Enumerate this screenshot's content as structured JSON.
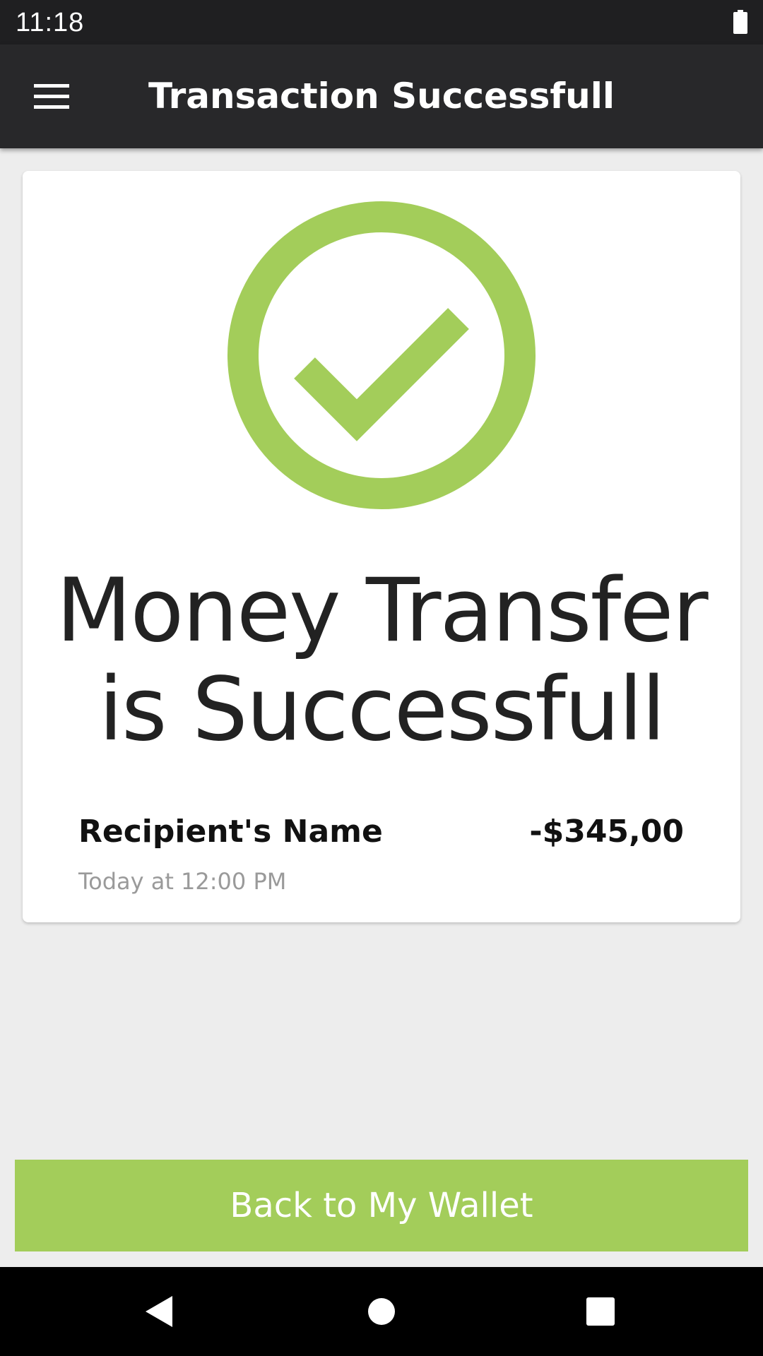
{
  "status_bar": {
    "time": "11:18",
    "battery_icon": "battery-full-icon"
  },
  "app_bar": {
    "menu_icon": "hamburger-menu-icon",
    "title": "Transaction Successfull"
  },
  "card": {
    "success_icon": "check-circle-icon",
    "headline": "Money Transfer is Successfull",
    "recipient_name": "Recipient's Name",
    "amount": "-$345,00",
    "time": "Today at 12:00 PM"
  },
  "action": {
    "wallet_button_label": "Back to My Wallet"
  },
  "nav_bar": {
    "back_icon": "back-triangle-icon",
    "home_icon": "home-circle-icon",
    "recents_icon": "recents-square-icon"
  },
  "colors": {
    "accent": "#a3cd5a",
    "app_bar": "#28282a",
    "status_bar": "#1f1f21",
    "background": "#ededed"
  }
}
